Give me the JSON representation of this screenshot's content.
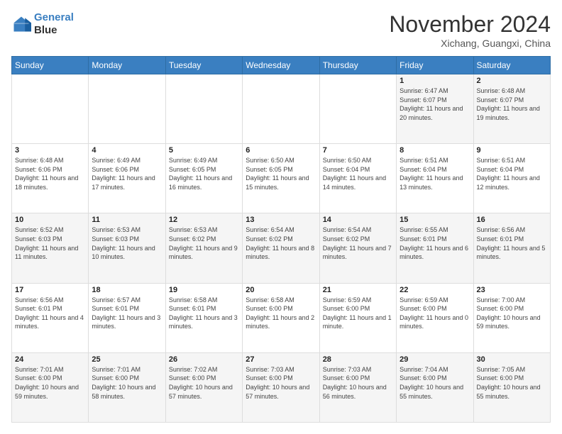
{
  "header": {
    "logo_line1": "General",
    "logo_line2": "Blue",
    "month": "November 2024",
    "location": "Xichang, Guangxi, China"
  },
  "weekdays": [
    "Sunday",
    "Monday",
    "Tuesday",
    "Wednesday",
    "Thursday",
    "Friday",
    "Saturday"
  ],
  "weeks": [
    [
      {
        "day": "",
        "info": ""
      },
      {
        "day": "",
        "info": ""
      },
      {
        "day": "",
        "info": ""
      },
      {
        "day": "",
        "info": ""
      },
      {
        "day": "",
        "info": ""
      },
      {
        "day": "1",
        "info": "Sunrise: 6:47 AM\nSunset: 6:07 PM\nDaylight: 11 hours and 20 minutes."
      },
      {
        "day": "2",
        "info": "Sunrise: 6:48 AM\nSunset: 6:07 PM\nDaylight: 11 hours and 19 minutes."
      }
    ],
    [
      {
        "day": "3",
        "info": "Sunrise: 6:48 AM\nSunset: 6:06 PM\nDaylight: 11 hours and 18 minutes."
      },
      {
        "day": "4",
        "info": "Sunrise: 6:49 AM\nSunset: 6:06 PM\nDaylight: 11 hours and 17 minutes."
      },
      {
        "day": "5",
        "info": "Sunrise: 6:49 AM\nSunset: 6:05 PM\nDaylight: 11 hours and 16 minutes."
      },
      {
        "day": "6",
        "info": "Sunrise: 6:50 AM\nSunset: 6:05 PM\nDaylight: 11 hours and 15 minutes."
      },
      {
        "day": "7",
        "info": "Sunrise: 6:50 AM\nSunset: 6:04 PM\nDaylight: 11 hours and 14 minutes."
      },
      {
        "day": "8",
        "info": "Sunrise: 6:51 AM\nSunset: 6:04 PM\nDaylight: 11 hours and 13 minutes."
      },
      {
        "day": "9",
        "info": "Sunrise: 6:51 AM\nSunset: 6:04 PM\nDaylight: 11 hours and 12 minutes."
      }
    ],
    [
      {
        "day": "10",
        "info": "Sunrise: 6:52 AM\nSunset: 6:03 PM\nDaylight: 11 hours and 11 minutes."
      },
      {
        "day": "11",
        "info": "Sunrise: 6:53 AM\nSunset: 6:03 PM\nDaylight: 11 hours and 10 minutes."
      },
      {
        "day": "12",
        "info": "Sunrise: 6:53 AM\nSunset: 6:02 PM\nDaylight: 11 hours and 9 minutes."
      },
      {
        "day": "13",
        "info": "Sunrise: 6:54 AM\nSunset: 6:02 PM\nDaylight: 11 hours and 8 minutes."
      },
      {
        "day": "14",
        "info": "Sunrise: 6:54 AM\nSunset: 6:02 PM\nDaylight: 11 hours and 7 minutes."
      },
      {
        "day": "15",
        "info": "Sunrise: 6:55 AM\nSunset: 6:01 PM\nDaylight: 11 hours and 6 minutes."
      },
      {
        "day": "16",
        "info": "Sunrise: 6:56 AM\nSunset: 6:01 PM\nDaylight: 11 hours and 5 minutes."
      }
    ],
    [
      {
        "day": "17",
        "info": "Sunrise: 6:56 AM\nSunset: 6:01 PM\nDaylight: 11 hours and 4 minutes."
      },
      {
        "day": "18",
        "info": "Sunrise: 6:57 AM\nSunset: 6:01 PM\nDaylight: 11 hours and 3 minutes."
      },
      {
        "day": "19",
        "info": "Sunrise: 6:58 AM\nSunset: 6:01 PM\nDaylight: 11 hours and 3 minutes."
      },
      {
        "day": "20",
        "info": "Sunrise: 6:58 AM\nSunset: 6:00 PM\nDaylight: 11 hours and 2 minutes."
      },
      {
        "day": "21",
        "info": "Sunrise: 6:59 AM\nSunset: 6:00 PM\nDaylight: 11 hours and 1 minute."
      },
      {
        "day": "22",
        "info": "Sunrise: 6:59 AM\nSunset: 6:00 PM\nDaylight: 11 hours and 0 minutes."
      },
      {
        "day": "23",
        "info": "Sunrise: 7:00 AM\nSunset: 6:00 PM\nDaylight: 10 hours and 59 minutes."
      }
    ],
    [
      {
        "day": "24",
        "info": "Sunrise: 7:01 AM\nSunset: 6:00 PM\nDaylight: 10 hours and 59 minutes."
      },
      {
        "day": "25",
        "info": "Sunrise: 7:01 AM\nSunset: 6:00 PM\nDaylight: 10 hours and 58 minutes."
      },
      {
        "day": "26",
        "info": "Sunrise: 7:02 AM\nSunset: 6:00 PM\nDaylight: 10 hours and 57 minutes."
      },
      {
        "day": "27",
        "info": "Sunrise: 7:03 AM\nSunset: 6:00 PM\nDaylight: 10 hours and 57 minutes."
      },
      {
        "day": "28",
        "info": "Sunrise: 7:03 AM\nSunset: 6:00 PM\nDaylight: 10 hours and 56 minutes."
      },
      {
        "day": "29",
        "info": "Sunrise: 7:04 AM\nSunset: 6:00 PM\nDaylight: 10 hours and 55 minutes."
      },
      {
        "day": "30",
        "info": "Sunrise: 7:05 AM\nSunset: 6:00 PM\nDaylight: 10 hours and 55 minutes."
      }
    ]
  ]
}
